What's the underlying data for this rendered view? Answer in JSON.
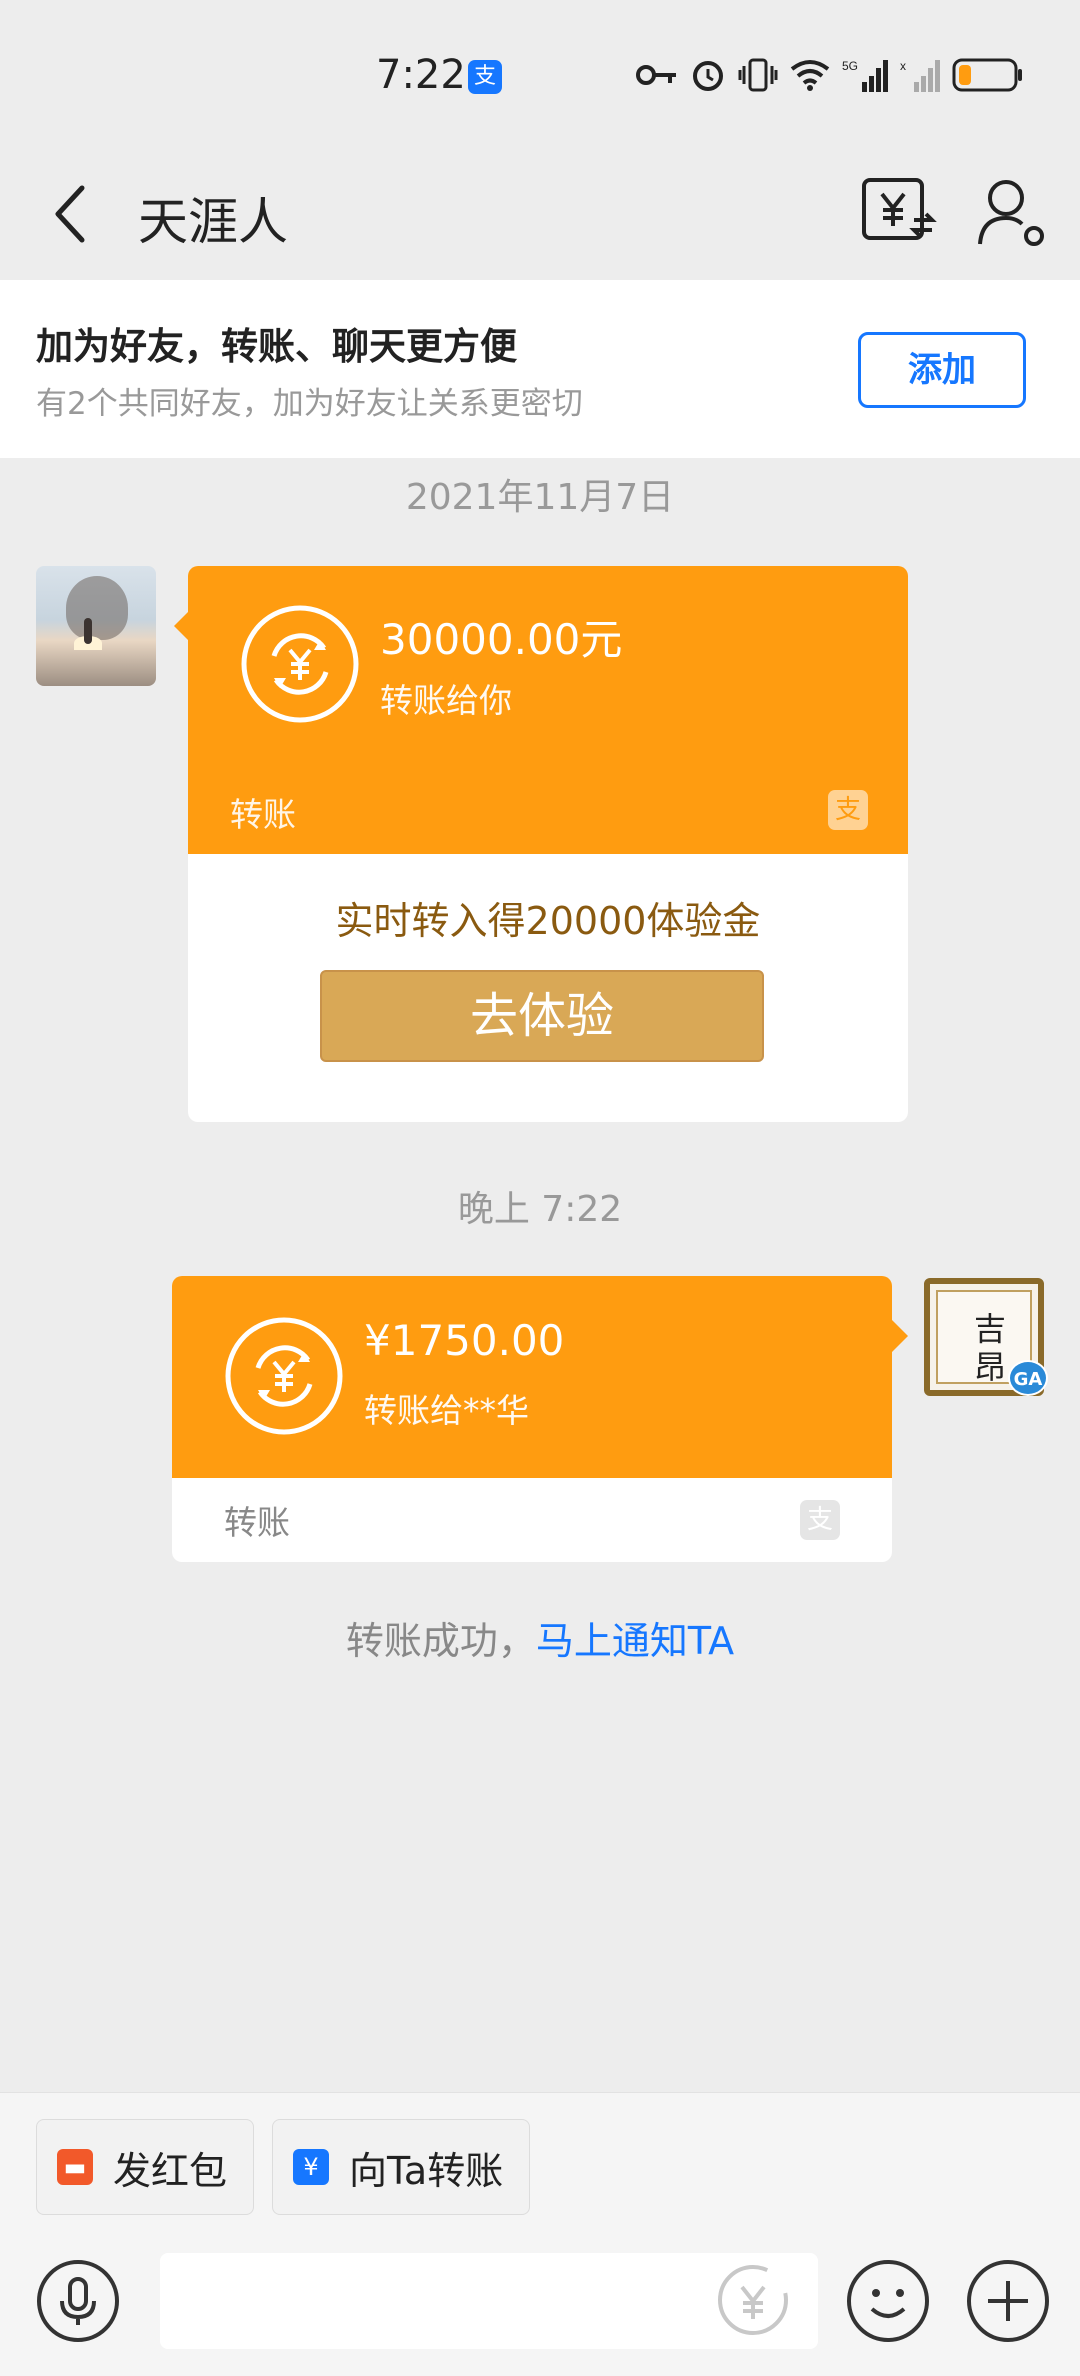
{
  "status_bar": {
    "time": "7:22",
    "battery_color": "#ff9c10"
  },
  "nav": {
    "title": "天涯人",
    "back_icon": "chevron-left-icon",
    "transfer_icon": "yuan-transfer-icon",
    "profile_icon": "user-settings-icon"
  },
  "friend_banner": {
    "title": "加为好友，转账、聊天更方便",
    "subtitle": "有2个共同好友，加为好友让关系更密切",
    "add_label": "添加"
  },
  "messages": {
    "date_label": "2021年11月7日",
    "time_label": "晚上 7:22",
    "incoming_transfer": {
      "amount": "30000.00元",
      "desc": "转账给你",
      "footer": "转账",
      "promo": "实时转入得20000体验金",
      "cta": "去体验"
    },
    "outgoing_transfer": {
      "amount": "¥1750.00",
      "desc": "转账给**华",
      "footer": "转账"
    },
    "right_avatar": {
      "char1": "吉",
      "char2": "昂",
      "badge": "GA"
    },
    "notify_prefix": "转账成功，",
    "notify_link": "马上通知TA"
  },
  "bottom_bar": {
    "red_packet_label": "发红包",
    "transfer_label": "向Ta转账",
    "input_placeholder": ""
  },
  "colors": {
    "accent_orange": "#ff9c10",
    "link_blue": "#1677ff",
    "promo_gold": "#d9a856"
  }
}
